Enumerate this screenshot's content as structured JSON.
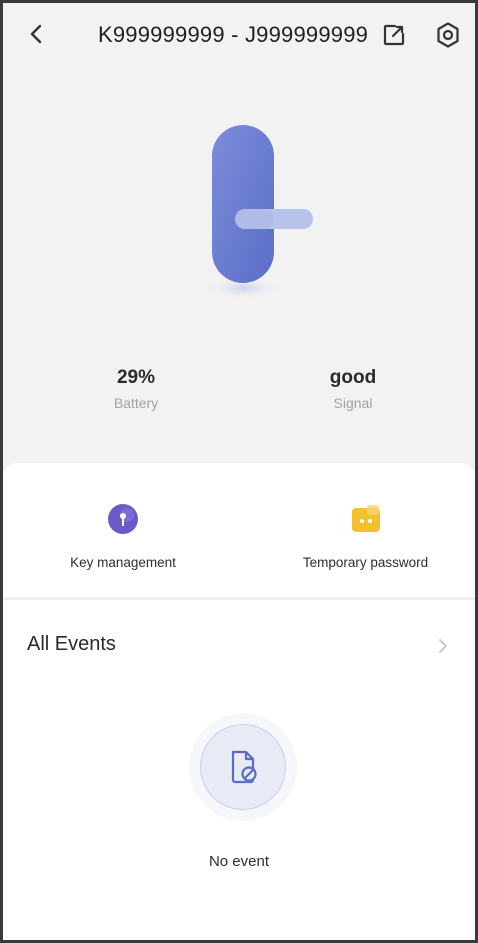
{
  "header": {
    "title": "K999999999 - J999999999",
    "back_icon": "chevron-left-icon",
    "share_icon": "external-link-icon",
    "settings_icon": "settings-icon"
  },
  "lock": {
    "illustration_icon": "door-lock-icon",
    "colors": {
      "body": "#6e7fd0",
      "handle": "#b8c3ec"
    }
  },
  "stats": {
    "battery": {
      "value": "29%",
      "label": "Battery"
    },
    "signal": {
      "value": "good",
      "label": "Signal"
    }
  },
  "actions": {
    "key_management": {
      "label": "Key management",
      "icon": "key-icon",
      "color": "#6a5bc9"
    },
    "temporary_password": {
      "label": "Temporary password",
      "icon": "password-icon",
      "color": "#f3c02e"
    }
  },
  "events": {
    "title": "All Events",
    "chevron_icon": "chevron-right-icon",
    "empty_label": "No event",
    "empty_icon": "document-blocked-icon"
  }
}
